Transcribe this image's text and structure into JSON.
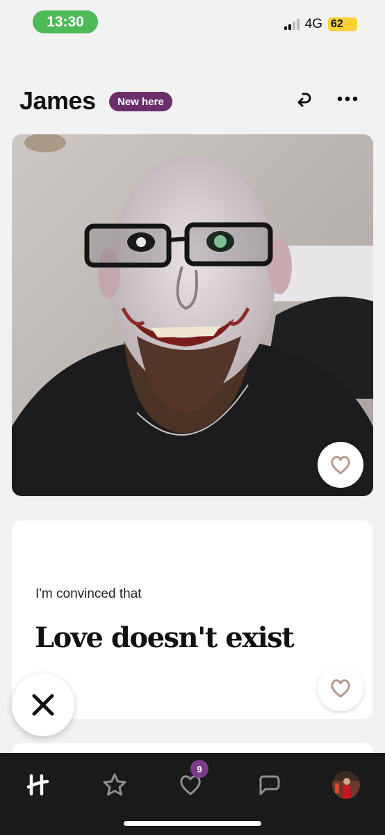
{
  "status_bar": {
    "time": "13:30",
    "network": "4G",
    "battery": "62"
  },
  "profile": {
    "name": "James",
    "badge": "New here"
  },
  "prompt": {
    "label": "I'm convinced that",
    "answer": "Love doesn't exist"
  },
  "tab_bar": {
    "tabs": [
      {
        "icon": "hinge-logo-icon",
        "active": true
      },
      {
        "icon": "star-icon"
      },
      {
        "icon": "likes-heart-icon",
        "count": "9"
      },
      {
        "icon": "chat-bubble-icon"
      },
      {
        "icon": "profile-avatar"
      }
    ]
  },
  "colors": {
    "status_time_bg": "#4dba55",
    "badge_bg": "#6b2e6b",
    "battery_bg": "#f7d13c",
    "tab_bar_bg": "#1a1a1a",
    "count_badge_bg": "#7a3c8a",
    "heart_stroke": "#b49a8e"
  }
}
